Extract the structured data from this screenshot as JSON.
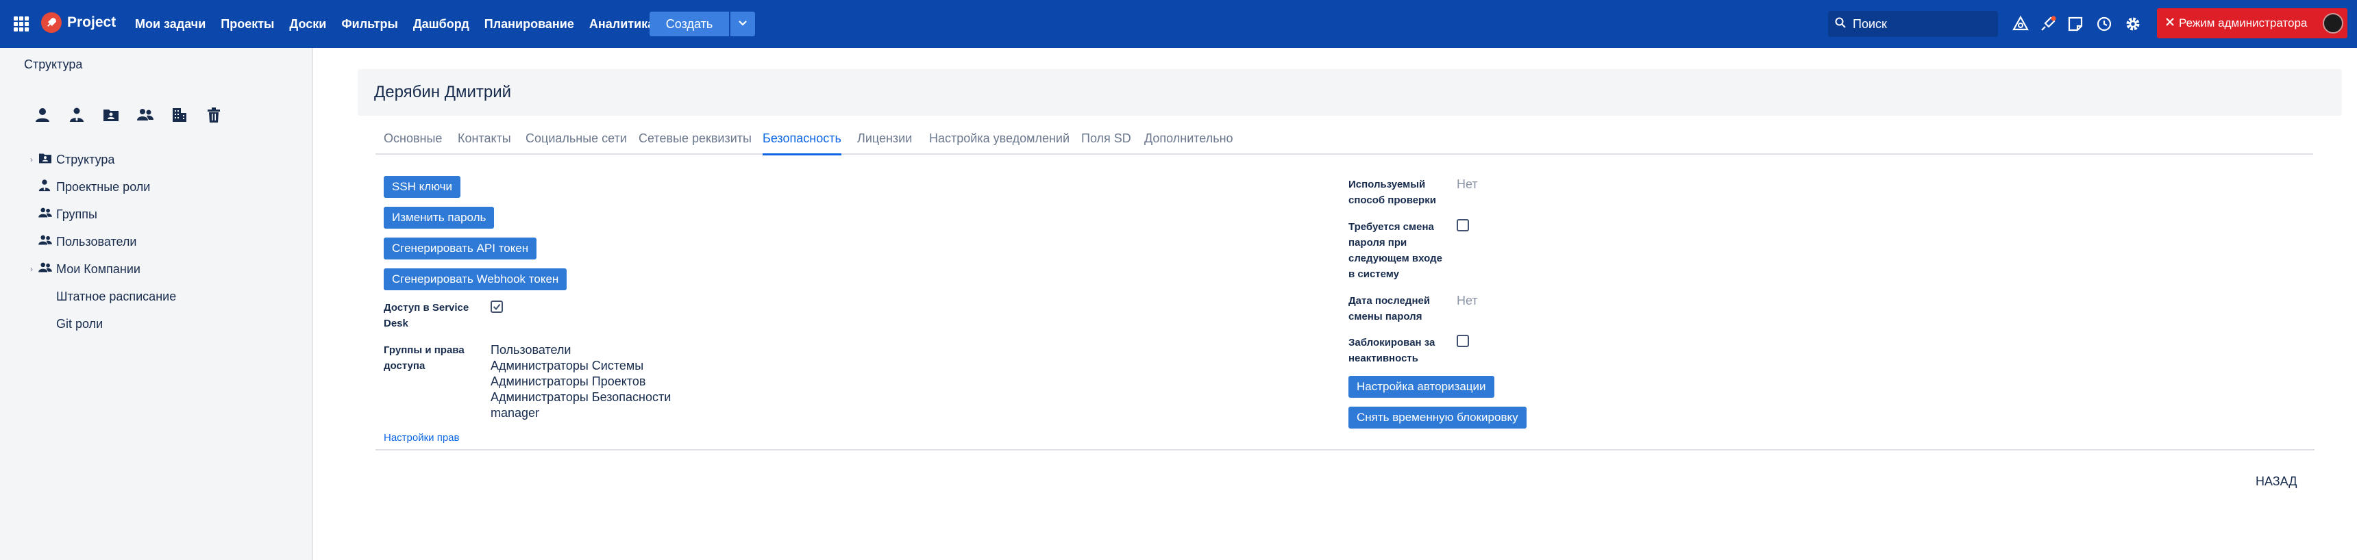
{
  "topbar": {
    "logo_text": "Project",
    "nav": [
      "Мои задачи",
      "Проекты",
      "Доски",
      "Фильтры",
      "Дашборд",
      "Планирование",
      "Аналитика"
    ],
    "create_label": "Создать",
    "search_placeholder": "Поиск",
    "admin_label": "Режим администратора",
    "accent": "#0c47ab",
    "admin_color": "#de1f27"
  },
  "sidebar": {
    "title": "Структура",
    "tools": [
      "user-icon",
      "user-tie-icon",
      "id-card-icon",
      "users-icon",
      "building-icon",
      "trash-icon"
    ],
    "items": [
      {
        "label": "Структура",
        "icon": "folder-user-icon",
        "caret": true
      },
      {
        "label": "Проектные роли",
        "icon": "user-tie-icon",
        "caret": false
      },
      {
        "label": "Группы",
        "icon": "users-icon",
        "caret": false
      },
      {
        "label": "Пользователи",
        "icon": "users-icon",
        "caret": false
      },
      {
        "label": "Мои Компании",
        "icon": "users-icon",
        "caret": true
      },
      {
        "label": "Штатное расписание",
        "icon": "",
        "caret": false
      },
      {
        "label": "Git роли",
        "icon": "",
        "caret": false
      }
    ]
  },
  "main": {
    "user_name": "Дерябин Дмитрий",
    "tabs": [
      "Основные",
      "Контакты",
      "Социальные сети",
      "Сетевые реквизиты",
      "Безопасность",
      "Лицензии",
      "Настройка уведомлений",
      "Поля SD",
      "Дополнительно"
    ],
    "active_tab": "Безопасность",
    "buttons": [
      "SSH ключи",
      "Изменить пароль",
      "Сгенерировать API токен",
      "Сгенерировать Webhook токен"
    ],
    "sd_access_label": "Доступ в Service Desk",
    "sd_access_checked": true,
    "groups_label": "Группы и права доступа",
    "groups": [
      "Пользователи",
      "Администраторы Системы",
      "Администраторы Проектов",
      "Администраторы Безопасности",
      "manager"
    ],
    "rights_link": "Настройки прав",
    "auth_method_label": "Используемый способ проверки",
    "auth_method_value": "Нет",
    "pwd_change_label": "Требуется смена пароля при следующем входе в систему",
    "pwd_change_checked": false,
    "last_pwd_label": "Дата последней смены пароля",
    "last_pwd_value": "Нет",
    "inactive_label": "Заблокирован за неактивность",
    "inactive_checked": false,
    "auth_settings_button": "Настройка авторизации",
    "unlock_button": "Снять временную блокировку",
    "back_label": "НАЗАД"
  }
}
